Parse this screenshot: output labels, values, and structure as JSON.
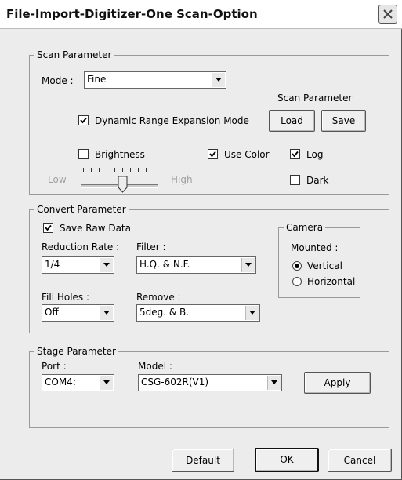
{
  "window": {
    "title": "File-Import-Digitizer-One Scan-Option"
  },
  "scan": {
    "legend": "Scan Parameter",
    "mode_label": "Mode :",
    "mode_value": "Fine",
    "dre_label": "Dynamic Range Expansion Mode",
    "dre_checked": true,
    "scan_param_label": "Scan Parameter",
    "load_label": "Load",
    "save_label": "Save",
    "brightness_label": "Brightness",
    "brightness_checked": false,
    "use_color_label": "Use Color",
    "use_color_checked": true,
    "log_label": "Log",
    "log_checked": true,
    "dark_label": "Dark",
    "dark_checked": false,
    "low_label": "Low",
    "high_label": "High",
    "slider_level": 0.5
  },
  "convert": {
    "legend": "Convert Parameter",
    "save_raw_label": "Save Raw Data",
    "save_raw_checked": true,
    "reduction_label": "Reduction Rate :",
    "reduction_value": "1/4",
    "filter_label": "Filter :",
    "filter_value": "H.Q. & N.F.",
    "fill_holes_label": "Fill Holes :",
    "fill_holes_value": "Off",
    "remove_label": "Remove :",
    "remove_value": "5deg. & B.",
    "camera": {
      "legend": "Camera",
      "mounted_label": "Mounted :",
      "vertical_label": "Vertical",
      "horizontal_label": "Horizontal",
      "selected": "Vertical"
    }
  },
  "stage": {
    "legend": "Stage Parameter",
    "port_label": "Port :",
    "port_value": "COM4:",
    "model_label": "Model :",
    "model_value": "CSG-602R(V1)",
    "apply_label": "Apply"
  },
  "footer": {
    "default_label": "Default",
    "ok_label": "OK",
    "cancel_label": "Cancel"
  }
}
